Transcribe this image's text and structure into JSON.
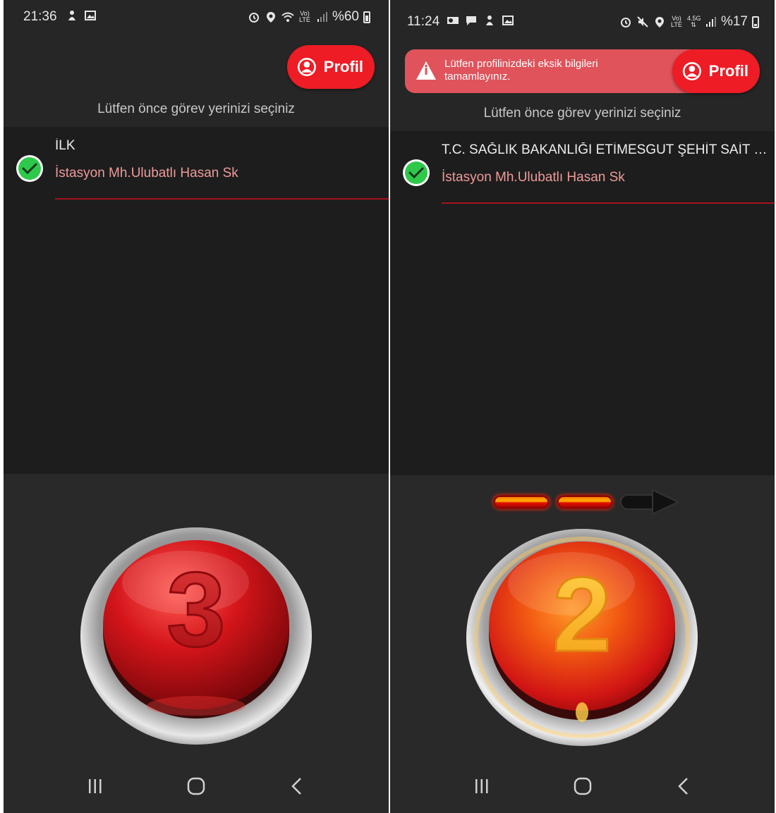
{
  "screens": [
    {
      "status": {
        "time": "21:36",
        "battery": "%60"
      },
      "profile_button": {
        "label": "Profil"
      },
      "prompt": "Lütfen önce görev yerinizi seçiniz",
      "item": {
        "title": "İLK",
        "address": "İstasyon Mh.Ulubatlı Hasan Sk"
      },
      "big_button_number": "3"
    },
    {
      "status": {
        "time": "11:24",
        "battery": "%17"
      },
      "warning_banner": {
        "text": "Lütfen profilinizdeki eksik bilgileri tamamlayınız."
      },
      "profile_button": {
        "label": "Profil"
      },
      "prompt": "Lütfen önce görev yerinizi seçiniz",
      "item": {
        "title": "T.C. SAĞLIK BAKANLIĞI ETİMESGUT ŞEHİT SAİT ER...",
        "address": "İstasyon Mh.Ulubatlı Hasan Sk"
      },
      "big_button_number": "2"
    }
  ],
  "icons": {
    "status_left": [
      "notification-icon",
      "image-icon"
    ],
    "status_right": [
      "alarm-icon",
      "location-icon",
      "wifi-icon",
      "volte-icon",
      "signal-icon",
      "battery-icon"
    ],
    "nav": [
      "recent-apps-icon",
      "home-icon",
      "back-icon"
    ]
  },
  "colors": {
    "accent_red": "#ee1c25",
    "banner_red": "#e0535b",
    "address_pink": "#ef9a9a",
    "check_green": "#2ec94a",
    "background": "#262626"
  }
}
